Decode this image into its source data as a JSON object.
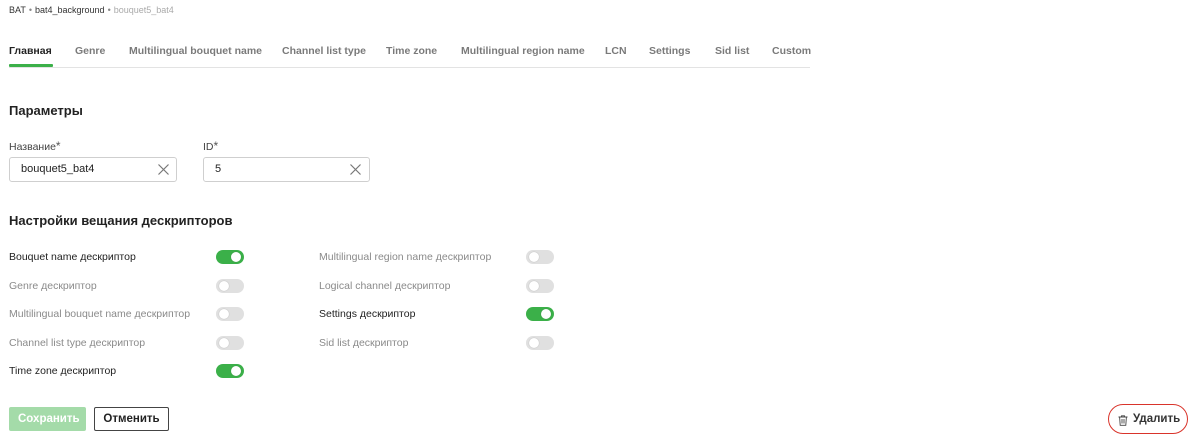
{
  "breadcrumb": {
    "root": "BAT",
    "parent": "bat4_background",
    "current": "bouquet5_bat4",
    "separator": "•"
  },
  "tabs": [
    {
      "label": "Главная",
      "active": true
    },
    {
      "label": "Genre"
    },
    {
      "label": "Multilingual bouquet name"
    },
    {
      "label": "Channel list type"
    },
    {
      "label": "Time zone"
    },
    {
      "label": "Multilingual region name"
    },
    {
      "label": "LCN"
    },
    {
      "label": "Settings"
    },
    {
      "label": "Sid list"
    },
    {
      "label": "Custom"
    }
  ],
  "params": {
    "title": "Параметры",
    "name": {
      "label": "Название",
      "required_mark": "*",
      "value": "bouquet5_bat4"
    },
    "id": {
      "label": "ID",
      "required_mark": "*",
      "value": "5"
    }
  },
  "descriptors": {
    "title": "Настройки вещания дескрипторов",
    "left": [
      {
        "label": "Bouquet name дескриптор",
        "enabled": true
      },
      {
        "label": "Genre дескриптор",
        "enabled": false
      },
      {
        "label": "Multilingual bouquet name дескриптор",
        "enabled": false
      },
      {
        "label": "Channel list type дескриптор",
        "enabled": false
      },
      {
        "label": "Time zone дескриптор",
        "enabled": true
      }
    ],
    "right": [
      {
        "label": "Multilingual region name дескриптор",
        "enabled": false
      },
      {
        "label": "Logical channel дескриптор",
        "enabled": false
      },
      {
        "label": "Settings дескриптор",
        "enabled": true
      },
      {
        "label": "Sid list дескриптор",
        "enabled": false
      }
    ]
  },
  "actions": {
    "save_label": "Сохранить",
    "cancel_label": "Отменить",
    "delete_label": "Удалить"
  },
  "colors": {
    "accent": "#3bb049",
    "save_disabled": "#a4dba9",
    "delete_outline": "#d9342b"
  },
  "icons": {
    "clear": "close-icon",
    "delete": "trash-icon"
  }
}
